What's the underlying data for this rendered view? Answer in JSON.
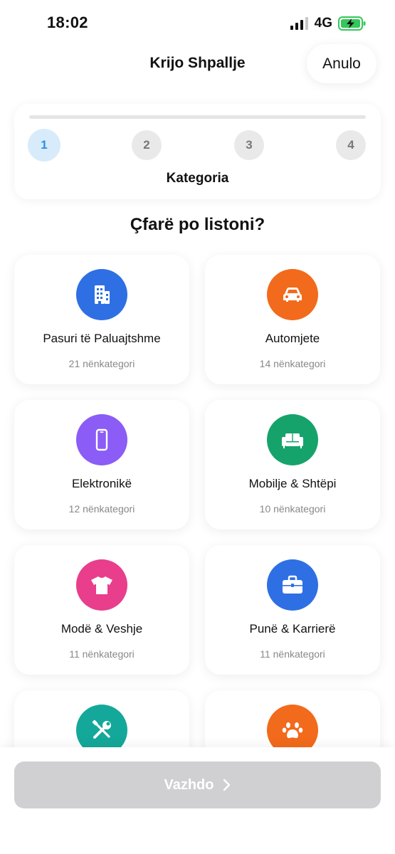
{
  "status_bar": {
    "time": "18:02",
    "network": "4G",
    "battery_icon": "battery-charging-icon",
    "battery_color": "#34c759"
  },
  "header": {
    "title": "Krijo Shpallje",
    "cancel_label": "Anulo"
  },
  "stepper": {
    "progress": 0,
    "active_step": 1,
    "steps": [
      "1",
      "2",
      "3",
      "4"
    ],
    "current_label": "Kategoria",
    "active_color": "#2f8fe0"
  },
  "question": "Çfarë po listoni?",
  "categories": [
    {
      "name": "Pasuri të Paluajtshme",
      "count": "21 nënkategori",
      "icon": "building-icon",
      "color": "#2f6fe4"
    },
    {
      "name": "Automjete",
      "count": "14 nënkategori",
      "icon": "car-icon",
      "color": "#f26a1b"
    },
    {
      "name": "Elektronikë",
      "count": "12 nënkategori",
      "icon": "phone-icon",
      "color": "#8b5cf6"
    },
    {
      "name": "Mobilje & Shtëpi",
      "count": "10 nënkategori",
      "icon": "sofa-icon",
      "color": "#16a36b"
    },
    {
      "name": "Modë & Veshje",
      "count": "11 nënkategori",
      "icon": "shirt-icon",
      "color": "#e83e8c"
    },
    {
      "name": "Punë & Karrierë",
      "count": "11 nënkategori",
      "icon": "briefcase-icon",
      "color": "#2f6fe4"
    },
    {
      "name": "",
      "count": "",
      "icon": "tools-icon",
      "color": "#14a89a"
    },
    {
      "name": "",
      "count": "",
      "icon": "paw-icon",
      "color": "#f26a1b"
    }
  ],
  "footer": {
    "continue_label": "Vazhdo",
    "continue_icon": "chevron-right-icon"
  }
}
